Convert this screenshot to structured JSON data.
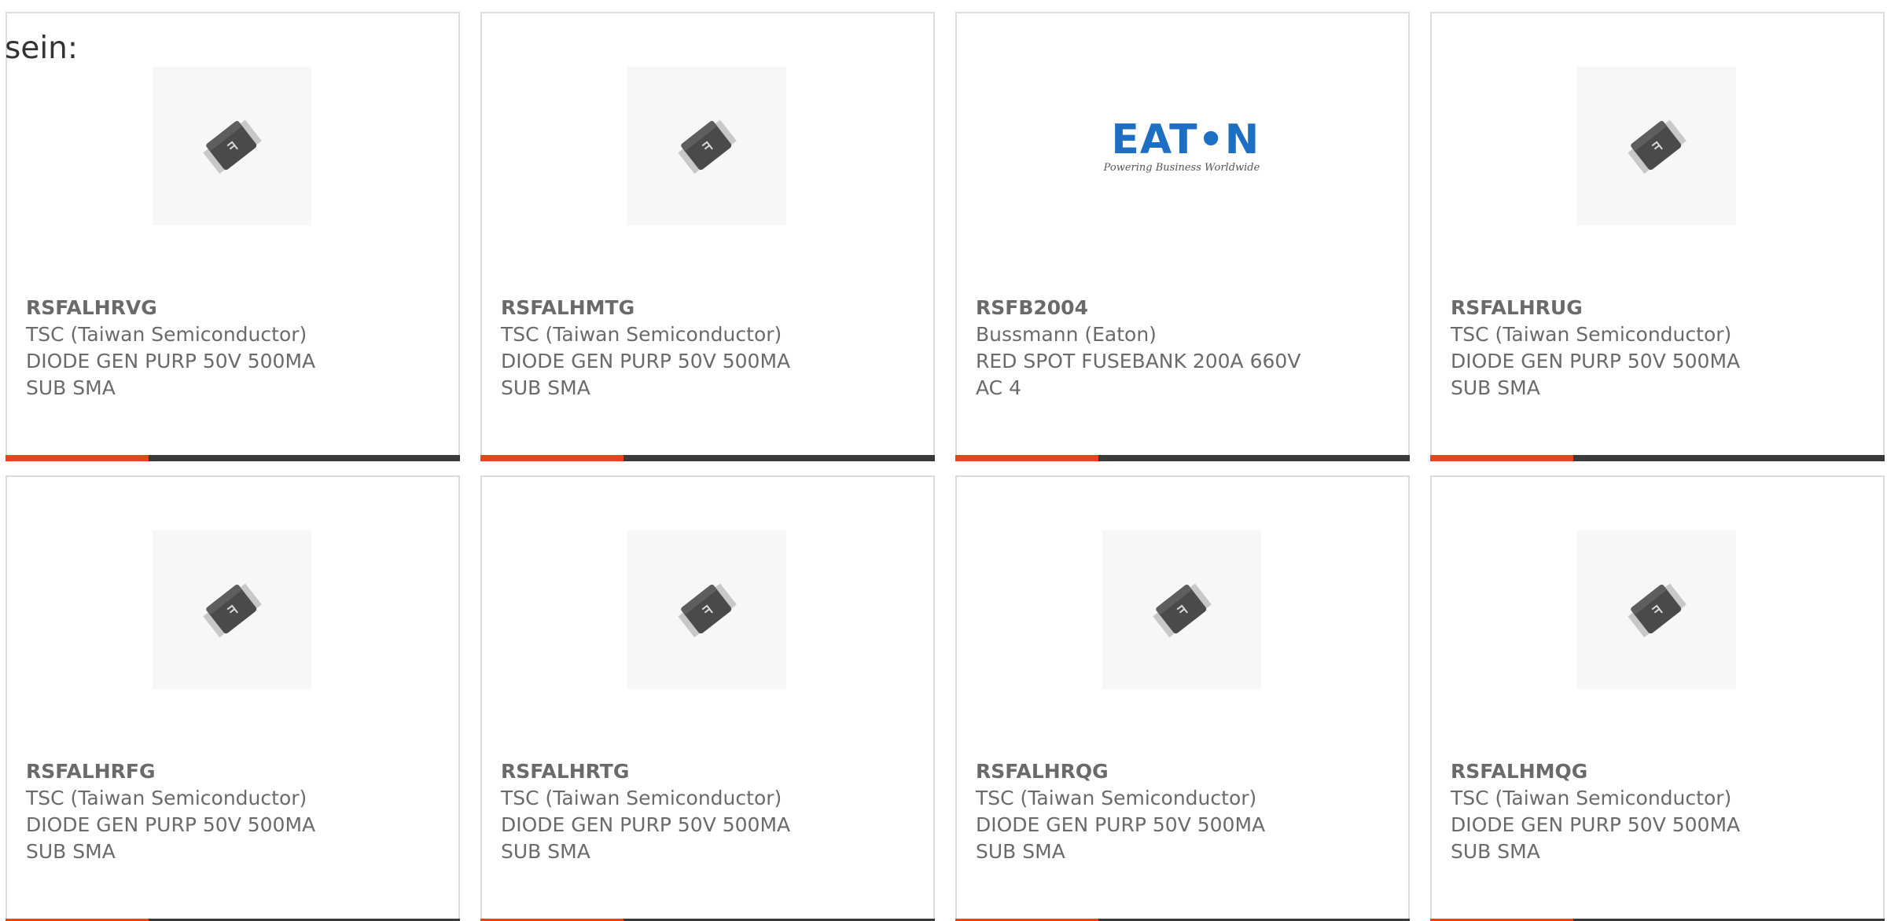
{
  "intro_text": "sein:",
  "colors": {
    "accent": "#e8431a",
    "bar": "#3a3a3a",
    "border": "#dcdcdc",
    "text": "#6a6a6a",
    "eaton_blue": "#1d6fc4"
  },
  "products": [
    {
      "part_number": "RSFALHRVG",
      "manufacturer": "TSC (Taiwan Semiconductor)",
      "desc_line1": "DIODE GEN PURP 50V 500MA",
      "desc_line2": "SUB SMA",
      "image_icon": "sma-diode-package-icon"
    },
    {
      "part_number": "RSFALHMTG",
      "manufacturer": "TSC (Taiwan Semiconductor)",
      "desc_line1": "DIODE GEN PURP 50V 500MA",
      "desc_line2": "SUB SMA",
      "image_icon": "sma-diode-package-icon"
    },
    {
      "part_number": "RSFB2004",
      "manufacturer": "Bussmann (Eaton)",
      "desc_line1": "RED SPOT FUSEBANK 200A 660V",
      "desc_line2": "AC 4",
      "image_icon": "eaton-logo",
      "logo_word": "EAT•N",
      "logo_tagline": "Powering Business Worldwide"
    },
    {
      "part_number": "RSFALHRUG",
      "manufacturer": "TSC (Taiwan Semiconductor)",
      "desc_line1": "DIODE GEN PURP 50V 500MA",
      "desc_line2": "SUB SMA",
      "image_icon": "sma-diode-package-icon"
    },
    {
      "part_number": "RSFALHRFG",
      "manufacturer": "TSC (Taiwan Semiconductor)",
      "desc_line1": "DIODE GEN PURP 50V 500MA",
      "desc_line2": "SUB SMA",
      "image_icon": "sma-diode-package-icon"
    },
    {
      "part_number": "RSFALHRTG",
      "manufacturer": "TSC (Taiwan Semiconductor)",
      "desc_line1": "DIODE GEN PURP 50V 500MA",
      "desc_line2": "SUB SMA",
      "image_icon": "sma-diode-package-icon"
    },
    {
      "part_number": "RSFALHRQG",
      "manufacturer": "TSC (Taiwan Semiconductor)",
      "desc_line1": "DIODE GEN PURP 50V 500MA",
      "desc_line2": "SUB SMA",
      "image_icon": "sma-diode-package-icon"
    },
    {
      "part_number": "RSFALHMQG",
      "manufacturer": "TSC (Taiwan Semiconductor)",
      "desc_line1": "DIODE GEN PURP 50V 500MA",
      "desc_line2": "SUB SMA",
      "image_icon": "sma-diode-package-icon"
    }
  ]
}
